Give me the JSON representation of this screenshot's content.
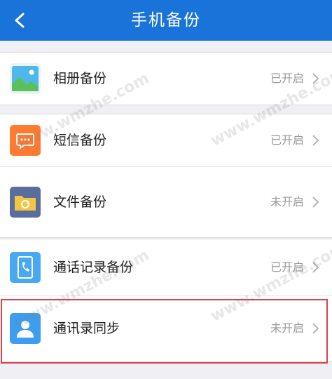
{
  "header": {
    "title": "手机备份"
  },
  "items": [
    {
      "label": "相册备份",
      "status": "已开启"
    },
    {
      "label": "短信备份",
      "status": "已开启"
    },
    {
      "label": "文件备份",
      "status": "未开启"
    },
    {
      "label": "通话记录备份",
      "status": "已开启"
    },
    {
      "label": "通讯录同步",
      "status": "未开启"
    }
  ],
  "watermark": "www.wmzhe.com",
  "colors": {
    "header": "#1a73d9",
    "album_icon": "#4fb8e8",
    "sms_icon": "#ff7b32",
    "file_icon": "#5a6e9e",
    "call_icon": "#48a9f0",
    "contacts_icon": "#3d9ef0",
    "highlight": "#d9434a"
  },
  "icons": [
    "back-arrow-icon",
    "album-icon",
    "sms-icon",
    "folder-icon",
    "call-log-icon",
    "contact-icon",
    "chevron-right-icon"
  ]
}
